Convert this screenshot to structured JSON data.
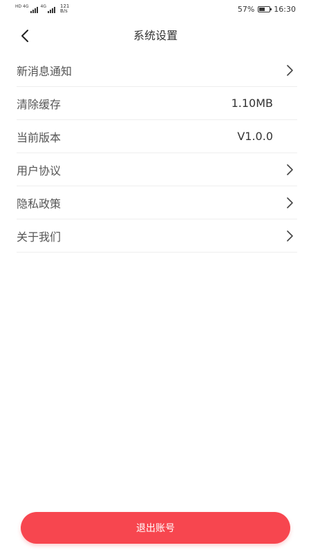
{
  "status_bar": {
    "sim1_tag": "HD 4G",
    "sim2_tag": "4G",
    "net_speed_value": "121",
    "net_speed_unit": "B/s",
    "battery_percent": "57%",
    "battery_level": 0.57,
    "time": "16:30"
  },
  "header": {
    "back_icon": "chevron-left-icon",
    "title": "系统设置"
  },
  "settings": {
    "items": [
      {
        "label": "新消息通知",
        "value": "",
        "icon": "chevron-right-icon"
      },
      {
        "label": "清除缓存",
        "value": "1.10MB",
        "icon": ""
      },
      {
        "label": "当前版本",
        "value": "V1.0.0",
        "icon": ""
      },
      {
        "label": "用户协议",
        "value": "",
        "icon": "chevron-right-icon"
      },
      {
        "label": "隐私政策",
        "value": "",
        "icon": "chevron-right-icon"
      },
      {
        "label": "关于我们",
        "value": "",
        "icon": "chevron-right-icon"
      }
    ]
  },
  "footer": {
    "logout_label": "退出账号"
  },
  "colors": {
    "accent": "#f7464f",
    "divider": "#eeeeee",
    "text": "#333333"
  }
}
